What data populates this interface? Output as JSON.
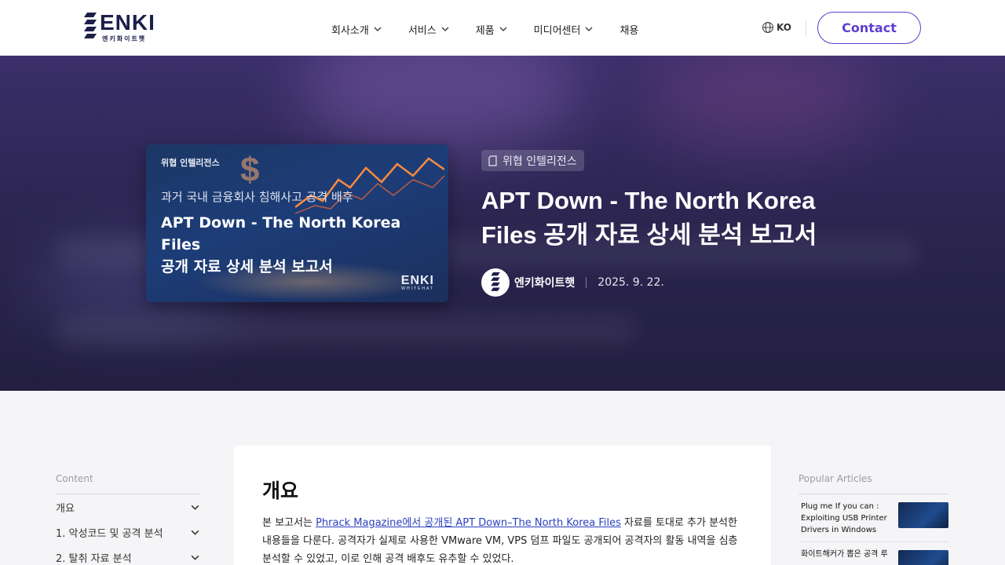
{
  "header": {
    "logo_text": "ENKI",
    "logo_sub": "엔키화이트햇",
    "nav": [
      {
        "label": "회사소개",
        "has_dropdown": true
      },
      {
        "label": "서비스",
        "has_dropdown": true
      },
      {
        "label": "제품",
        "has_dropdown": true
      },
      {
        "label": "미디어센터",
        "has_dropdown": true
      },
      {
        "label": "채용",
        "has_dropdown": false
      }
    ],
    "lang_label": "KO",
    "contact_label": "Contact",
    "accent_color": "#5b3fd0"
  },
  "hero": {
    "thumbnail": {
      "category": "위협 인텔리전스",
      "subtitle": "과거 국내 금융회사 침해사고 공격 배후",
      "title_line1": "APT Down - The North Korea Files",
      "title_line2": "공개 자료 상세 분석 보고서",
      "logo": "ENKI",
      "logo_sub": "WHITEHAT"
    },
    "category_badge": "위협 인텔리전스",
    "title": "APT Down - The North Korea Files 공개 자료 상세 분석 보고서",
    "author": "엔키화이트햇",
    "date": "2025. 9. 22."
  },
  "toc": {
    "heading": "Content",
    "items": [
      "개요",
      "1. 악성코드 및 공격 분석",
      "2. 탈취 자료 분석"
    ]
  },
  "article": {
    "heading": "개요",
    "para_prefix": "본 보고서는 ",
    "link_text": "Phrack Magazine에서 공개된 APT Down–The North Korea Files",
    "para_rest": " 자료를 토대로 추가 분석한 내용들을 다룬다. 공격자가 실제로 사용한 VMware VM, VPS 덤프 파일도 공개되어 공격자의 활동 내역을 심층 분석할 수 있었고, 이로 인해 공격 배후도 유추할 수 있었다."
  },
  "popular": {
    "heading": "Popular Articles",
    "items": [
      {
        "title": "Plug me If you can : Exploiting USB Printer Drivers in Windows"
      },
      {
        "title": "화이트해커가 뽑은 공격 루"
      }
    ]
  }
}
